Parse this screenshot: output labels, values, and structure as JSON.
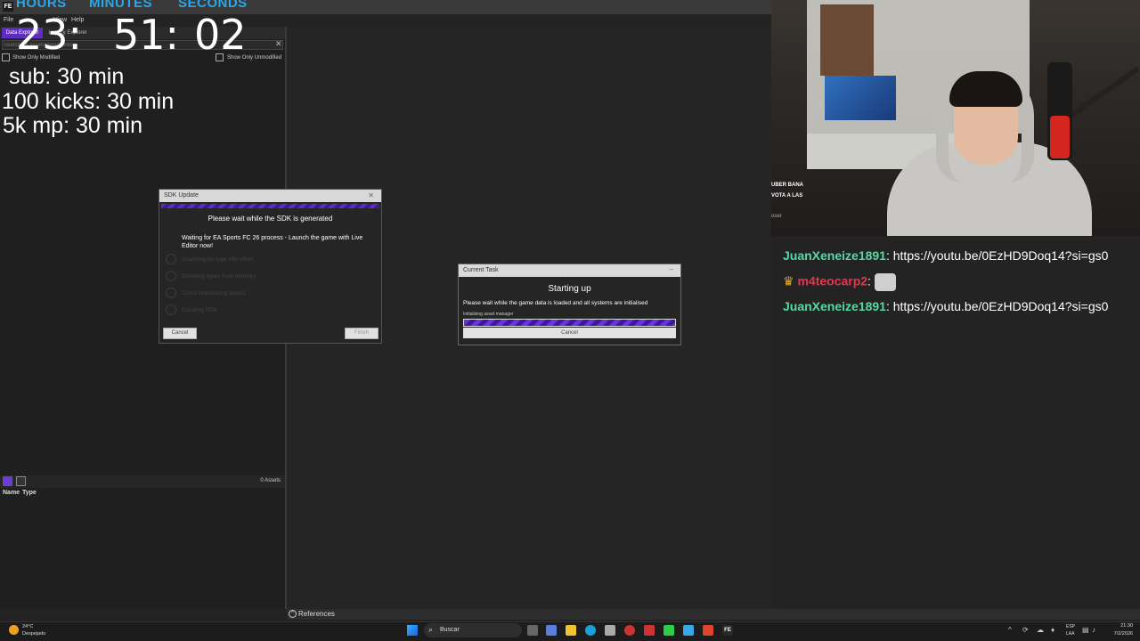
{
  "app": {
    "logo": "FE",
    "menu": [
      "File",
      "View",
      "Help"
    ],
    "tabs": [
      "Data Explorer",
      "Legacy Explorer"
    ],
    "search_placeholder": "Search for assets/legacy files",
    "filters": {
      "modified": "Show Only Modified",
      "unmodified": "Show Only Unmodified"
    },
    "assets_count": "0 Assets",
    "columns": {
      "name": "Name",
      "type": "Type"
    },
    "references_label": "References"
  },
  "timer": {
    "labels": {
      "hours": "HOURS",
      "minutes": "MINUTES",
      "seconds": "SECONDS"
    },
    "hours": "23:",
    "minutes": "51:",
    "seconds": "02"
  },
  "goals": [
    "sub: 30 min",
    "100 kicks: 30 min",
    "5k mp: 30 min"
  ],
  "sdk_dialog": {
    "title": "SDK Update",
    "heading": "Please wait while the SDK is generated",
    "message": "Waiting for EA Sports FC 26 process - Launch the game with Live Editor now!",
    "steps": [
      "Scanning for type info offset",
      "Dumping types from memory",
      "Cross referencing assets",
      "Creating SDK"
    ],
    "cancel": "Cancel",
    "finish": "Finish"
  },
  "task_dialog": {
    "title": "Current Task",
    "heading": "Starting up",
    "message": "Please wait while the game data is loaded and all systems are initialised",
    "status": "Initialising asset manager",
    "progress": 1.0,
    "cancel": "Cancel"
  },
  "webcam_overlay": {
    "line1": "UBER BANA",
    "line2": "VOTA A LAS",
    "line3": "oser"
  },
  "chat": [
    {
      "user": "JuanXeneize1891",
      "user_color": "#57d9a3",
      "text": ": https://youtu.be/0EzHD9Doq14?si=gs0"
    },
    {
      "user": "m4teocarp2",
      "user_color": "#e8344a",
      "text": ":",
      "badge": "crown-icon"
    },
    {
      "user": "JuanXeneize1891",
      "user_color": "#57d9a3",
      "text": ": https://youtu.be/0EzHD9Doq14?si=gs0"
    }
  ],
  "taskbar": {
    "weather_temp": "24°C",
    "weather_desc": "Despejado",
    "search_label": "Buscar",
    "lang_top": "ESP",
    "lang_bottom": "LAA",
    "time": "21:30",
    "date": "7/2/2026"
  },
  "colors": {
    "accent": "#5d2dbf",
    "timer_label": "#2aa7e8"
  }
}
